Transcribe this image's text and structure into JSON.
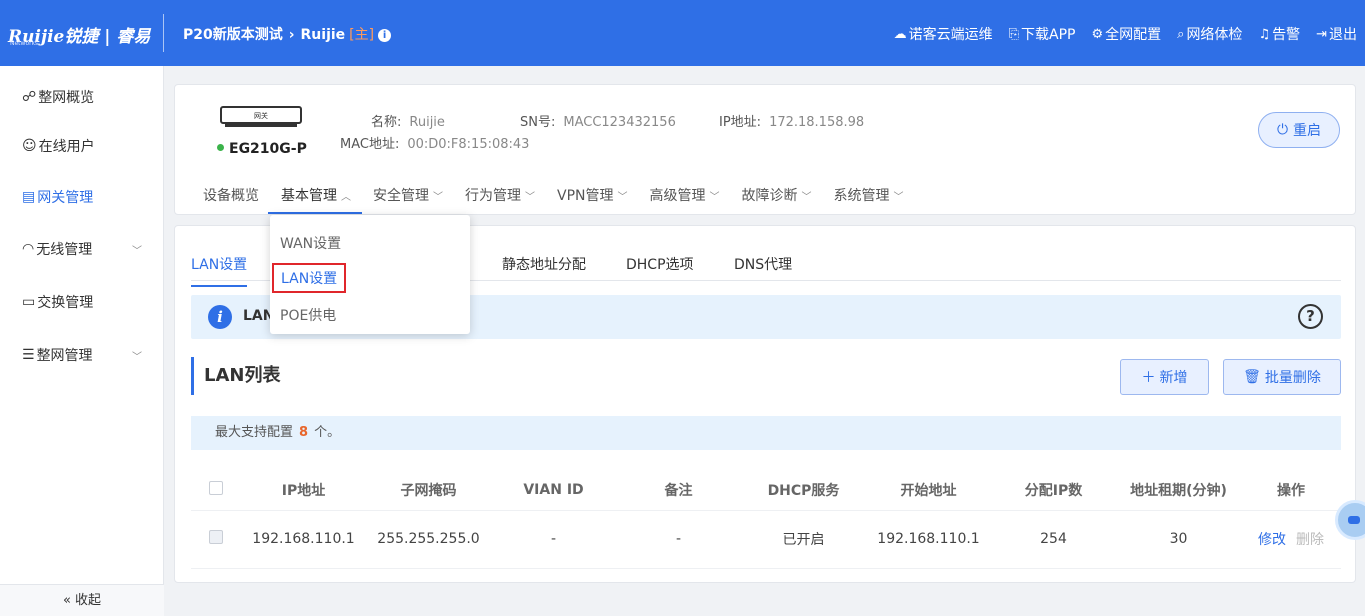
{
  "header": {
    "logo": "Ruijie锐捷 | 睿易",
    "logo_sub": "Networks",
    "project": "P20新版本测试",
    "device": "Ruijie",
    "master_tag": "[主]",
    "actions": [
      {
        "icon": "cloud-icon",
        "label": "诺客云端运维"
      },
      {
        "icon": "download-app-icon",
        "label": "下载APP"
      },
      {
        "icon": "network-config-icon",
        "label": "全网配置"
      },
      {
        "icon": "network-check-icon",
        "label": "网络体检"
      },
      {
        "icon": "alarm-icon",
        "label": "告警"
      },
      {
        "icon": "logout-icon",
        "label": "退出"
      }
    ]
  },
  "sidebar": {
    "items": [
      {
        "icon": "topology-icon",
        "label": "整网概览",
        "active": false
      },
      {
        "icon": "user-icon",
        "label": "在线用户",
        "active": false
      },
      {
        "icon": "gateway-icon",
        "label": "网关管理",
        "active": true
      },
      {
        "icon": "wifi-icon",
        "label": "无线管理",
        "active": false
      },
      {
        "icon": "switch-icon",
        "label": "交换管理",
        "active": false
      },
      {
        "icon": "settings-list-icon",
        "label": "整网管理",
        "active": false
      }
    ],
    "collapse_label": "收起"
  },
  "device": {
    "image_label": "网关",
    "model": "EG210G-P",
    "status_color": "#3bb34a",
    "name_label": "名称:",
    "name_value": "Ruijie",
    "sn_label": "SN号:",
    "sn_value": "MACC123432156",
    "ip_label": "IP地址:",
    "ip_value": "172.18.158.98",
    "mac_label": "MAC地址:",
    "mac_value": "00:D0:F8:15:08:43",
    "reboot_label": "重启"
  },
  "menu": [
    {
      "label": "设备概览",
      "has_caret": false
    },
    {
      "label": "基本管理",
      "has_caret": true,
      "active": true
    },
    {
      "label": "安全管理",
      "has_caret": true
    },
    {
      "label": "行为管理",
      "has_caret": true
    },
    {
      "label": "VPN管理",
      "has_caret": true
    },
    {
      "label": "高级管理",
      "has_caret": true
    },
    {
      "label": "故障诊断",
      "has_caret": true
    },
    {
      "label": "系统管理",
      "has_caret": true
    }
  ],
  "dropdown": {
    "items": [
      "WAN设置",
      "LAN设置",
      "POE供电"
    ],
    "selected": "LAN设置"
  },
  "tabs": [
    "LAN设置",
    "静态地址分配",
    "DHCP选项",
    "DNS代理"
  ],
  "notice_text": "LAN",
  "list_title": "LAN列表",
  "buttons": {
    "add": "新增",
    "batch_delete": "批量删除"
  },
  "limit": {
    "prefix": "最大支持配置",
    "count": "8",
    "suffix": "个。"
  },
  "table": {
    "headers": [
      "IP地址",
      "子网掩码",
      "VIAN ID",
      "备注",
      "DHCP服务",
      "开始地址",
      "分配IP数",
      "地址租期(分钟)",
      "操作"
    ],
    "rows": [
      {
        "ip": "192.168.110.1",
        "mask": "255.255.255.0",
        "vlan": "-",
        "remark": "-",
        "dhcp": "已开启",
        "start": "192.168.110.1",
        "count": "254",
        "lease": "30",
        "edit": "修改",
        "delete": "删除"
      }
    ]
  }
}
